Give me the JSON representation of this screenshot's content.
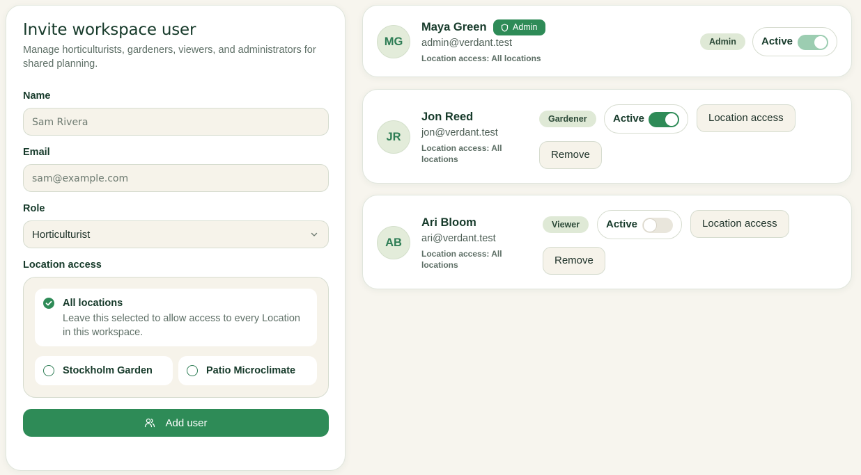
{
  "form": {
    "title": "Invite workspace user",
    "subtitle": "Manage horticulturists, gardeners, viewers, and administrators for shared planning.",
    "name_label": "Name",
    "name_placeholder": "Sam Rivera",
    "email_label": "Email",
    "email_placeholder": "sam@example.com",
    "role_label": "Role",
    "role_value": "Horticulturist",
    "location_label": "Location access",
    "all_locations_title": "All locations",
    "all_locations_desc": "Leave this selected to allow access to every Location in this workspace.",
    "locations": [
      "Stockholm Garden",
      "Patio Microclimate"
    ],
    "add_button": "Add user"
  },
  "users": [
    {
      "initials": "MG",
      "name": "Maya Green",
      "badge": "Admin",
      "email": "admin@verdant.test",
      "location": "Location access: All locations",
      "role": "Admin",
      "status": "Active",
      "active": true
    },
    {
      "initials": "JR",
      "name": "Jon Reed",
      "email": "jon@verdant.test",
      "location": "Location access: All locations",
      "role": "Gardener",
      "status": "Active",
      "active": true,
      "location_button": "Location access",
      "remove_button": "Remove"
    },
    {
      "initials": "AB",
      "name": "Ari Bloom",
      "email": "ari@verdant.test",
      "location": "Location access: All locations",
      "role": "Viewer",
      "status": "Active",
      "active": false,
      "location_button": "Location access",
      "remove_button": "Remove"
    }
  ],
  "colors": {
    "accent": "#2e8b57",
    "background": "#f7f5ee",
    "pill": "#dfe9d6"
  }
}
